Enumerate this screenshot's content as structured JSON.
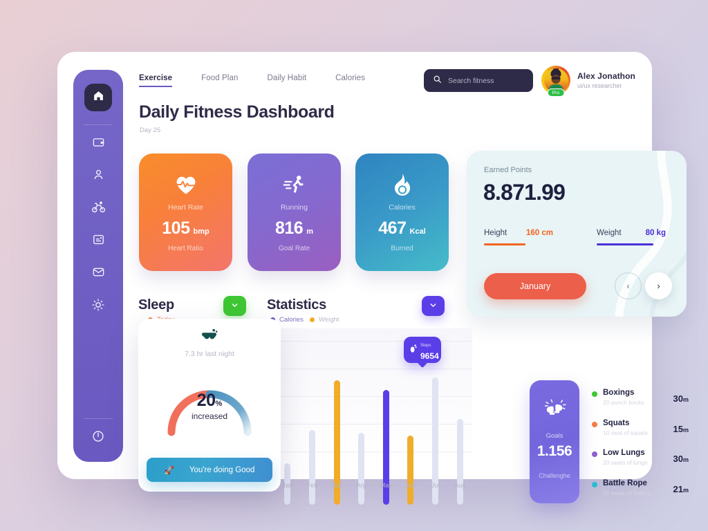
{
  "sidebar": {
    "items": [
      {
        "name": "home",
        "icon": "home-icon",
        "active": true
      },
      {
        "name": "wallet",
        "icon": "wallet-icon",
        "active": false
      },
      {
        "name": "profile",
        "icon": "user-icon",
        "active": false
      },
      {
        "name": "cycling",
        "icon": "bicycle-icon",
        "active": false
      },
      {
        "name": "notes",
        "icon": "note-icon",
        "active": false
      },
      {
        "name": "mail",
        "icon": "envelope-icon",
        "active": false
      },
      {
        "name": "theme",
        "icon": "sun-icon",
        "active": false
      }
    ],
    "bottom": {
      "name": "logout",
      "icon": "power-icon"
    }
  },
  "nav": {
    "tabs": [
      {
        "label": "Exercise",
        "active": true
      },
      {
        "label": "Food Plan",
        "active": false
      },
      {
        "label": "Daily Habit",
        "active": false
      },
      {
        "label": "Calories",
        "active": false
      }
    ]
  },
  "search": {
    "placeholder": "Search fitness",
    "value": "",
    "icon": "search-icon"
  },
  "profile": {
    "name": "Alex Jonathon",
    "role": "ui/ux researcher",
    "badge": "Pro"
  },
  "header": {
    "title": "Daily Fitness Dashboard",
    "subtitle": "Day 25"
  },
  "stats": [
    {
      "icon": "heart-pulse-icon",
      "label": "Heart Rate",
      "value": "105",
      "unit": "bmp",
      "footer": "Heart Ratio"
    },
    {
      "icon": "running-icon",
      "label": "Running",
      "value": "816",
      "unit": "m",
      "footer": "Goal Rate"
    },
    {
      "icon": "flame-icon",
      "label": "Calories",
      "value": "467",
      "unit": "Kcal",
      "footer": "Burned"
    }
  ],
  "points": {
    "label": "Earned Points",
    "value": "8.871.99",
    "metrics": [
      {
        "name": "Height",
        "value": "160",
        "unit": "cm",
        "color": "#f4641f",
        "fill": 60
      },
      {
        "name": "Weight",
        "value": "80",
        "unit": "kg",
        "color": "#4b2fd6",
        "fill": 82
      }
    ],
    "month_button": "January",
    "prev_icon": "chevron-left-icon",
    "next_icon": "chevron-right-icon"
  },
  "sleep": {
    "heading": "Sleep",
    "dropdown_icon": "chevron-down-icon",
    "legend": {
      "label": "Today",
      "color": "#f47b45"
    },
    "icon": "sleep-mask-icon",
    "hours": "7.3 hr last night",
    "gauge_value": "20",
    "gauge_percent": "%",
    "gauge_sub": "increased",
    "cta": {
      "label": "You're doing Good",
      "icon": "rocket-icon"
    }
  },
  "statistics": {
    "heading": "Statistics",
    "dropdown_icon": "chevron-down-icon",
    "legend": [
      {
        "label": "Calories",
        "color": "#6a59c0"
      },
      {
        "label": "Weight",
        "color": "#f0ad2a"
      }
    ],
    "tooltip": {
      "label": "Steps",
      "value": "9654",
      "icon": "footprint-icon"
    }
  },
  "chart_data": {
    "type": "bar",
    "title": "Statistics",
    "categories": [
      "Jan",
      "Feb",
      "Mar",
      "Arp",
      "May",
      "Jun",
      "Jul",
      "Aug"
    ],
    "values": [
      30,
      54,
      90,
      52,
      83,
      50,
      92,
      62
    ],
    "colors": [
      "#dfe3f2",
      "#dfe3f2",
      "#f0ad2a",
      "#dfe3f2",
      "#5b3ee8",
      "#f0ad2a",
      "#dfe3f2",
      "#dfe3f2"
    ],
    "xlabel": "",
    "ylabel": "",
    "ylim": [
      0,
      100
    ],
    "grid": true,
    "legend_position": "top-left",
    "annotation": {
      "category": "May",
      "label": "Steps",
      "value": "9654"
    }
  },
  "goals": {
    "icon": "boxing-gloves-icon",
    "label": "Goals",
    "value": "1.156",
    "sub": "Challenghe"
  },
  "exercises": [
    {
      "name": "Boxings",
      "sub": "20 punch bocks",
      "duration": "30",
      "unit": "m",
      "color": "#3ec733"
    },
    {
      "name": "Squats",
      "sub": "10 seat of squats",
      "duration": "15",
      "unit": "m",
      "color": "#f47b45"
    },
    {
      "name": "Low Lungs",
      "sub": "20 seats of lungs",
      "duration": "30",
      "unit": "m",
      "color": "#8b5fd0"
    },
    {
      "name": "Battle Rope",
      "sub": "15 seats of batting",
      "duration": "21",
      "unit": "m",
      "color": "#2bbcd4"
    }
  ]
}
